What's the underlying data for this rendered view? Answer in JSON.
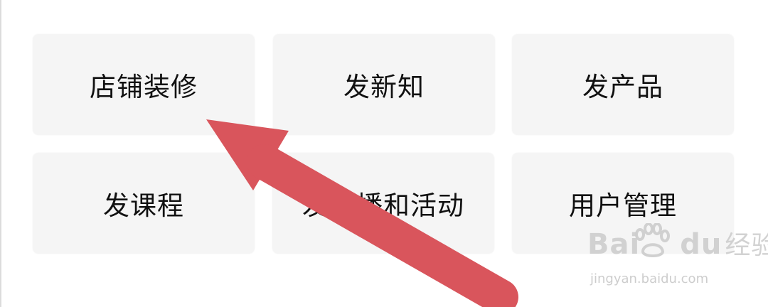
{
  "menu": {
    "tiles": [
      {
        "label": "店铺装修"
      },
      {
        "label": "发新知"
      },
      {
        "label": "发产品"
      },
      {
        "label": "发课程"
      },
      {
        "label": "发直播和活动"
      },
      {
        "label": "用户管理"
      }
    ]
  },
  "annotation": {
    "arrow_color": "#d9555c",
    "arrow_target": "店铺装修"
  },
  "watermark": {
    "brand": "Bai",
    "brand_suffix": "du",
    "product": "经验",
    "url": "jingyan.baidu.com",
    "icon": "paw-icon"
  },
  "colors": {
    "tile_background": "#f5f5f5",
    "page_background": "#ffffff",
    "text": "#111111"
  }
}
